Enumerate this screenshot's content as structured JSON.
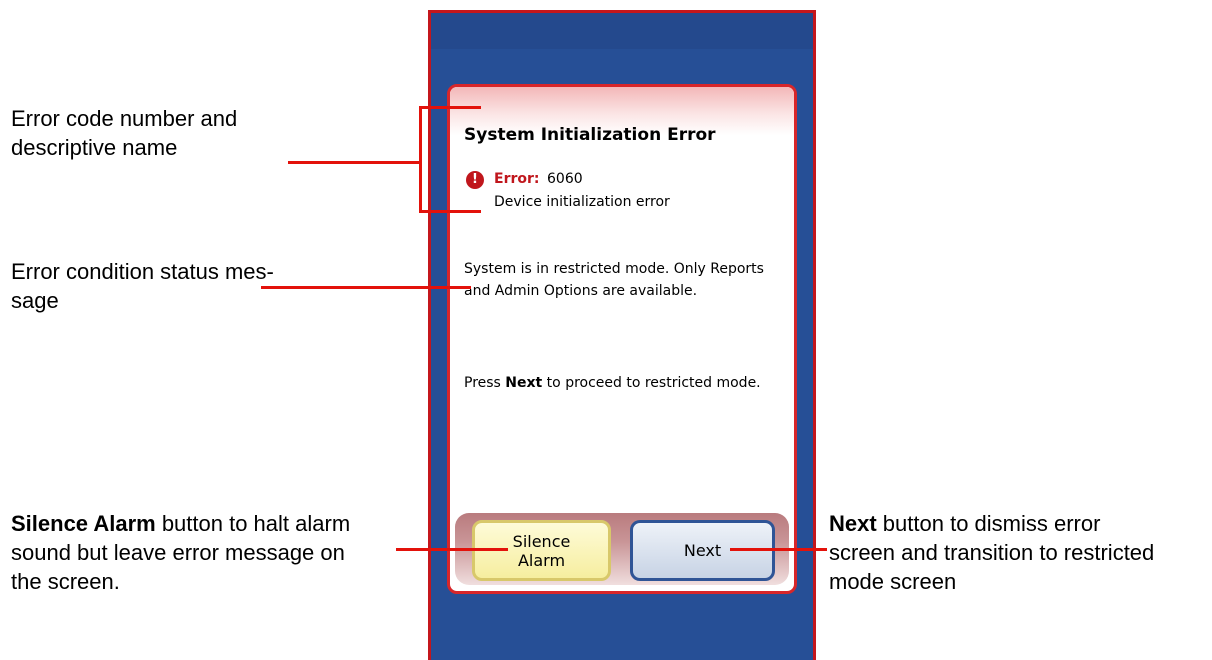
{
  "callouts": {
    "error_code_line1": "Error code number and",
    "error_code_line2": "descriptive name",
    "status_line1": "Error condition status mes-",
    "status_line2": "sage",
    "silence_bold": "Silence Alarm",
    "silence_rest1": " button to halt alarm",
    "silence_line2": "sound but leave error message on",
    "silence_line3": "the screen.",
    "next_bold": "Next",
    "next_rest1": " button to dismiss error",
    "next_line2": "screen and transition to restricted",
    "next_line3": "mode screen"
  },
  "dialog": {
    "title": "System Initialization Error",
    "error_label": "Error:",
    "error_code": "6060",
    "error_description": "Device initialization error",
    "status_message": "System is in restricted mode.  Only Reports and Admin Options are available.",
    "instruction_pre": "Press ",
    "instruction_bold": "Next",
    "instruction_post": " to proceed to restricted mode."
  },
  "buttons": {
    "silence_alarm": "Silence Alarm",
    "next": "Next"
  },
  "colors": {
    "callout_line": "#e3120b",
    "device_bg": "#264f96",
    "error_red": "#c0161c"
  }
}
